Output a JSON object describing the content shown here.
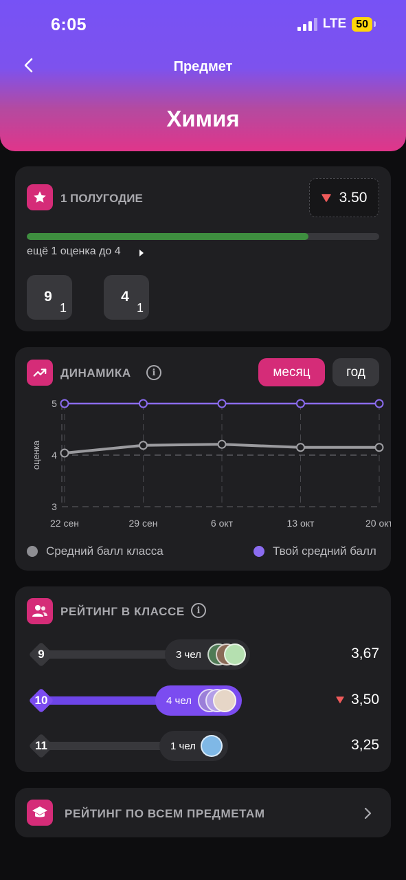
{
  "status_bar": {
    "time": "6:05",
    "network": "LTE",
    "battery": "50"
  },
  "nav": {
    "title": "Предмет",
    "back_icon": "chevron-left-icon"
  },
  "subject": "Химия",
  "semester_card": {
    "title": "1 ПОЛУГОДИЕ",
    "icon": "star-icon",
    "average": "3.50",
    "progress": 0.8,
    "progress_color": "#3e8e3f",
    "hint": "ещё 1 оценка до 4",
    "grades": [
      {
        "grade": "9",
        "count": "1"
      },
      {
        "grade": "4",
        "count": "1"
      }
    ]
  },
  "dynamics_card": {
    "title": "ДИНАМИКА",
    "icon": "trend-up-icon",
    "toggle": {
      "month": "месяц",
      "year": "год",
      "active": "month"
    },
    "legend": {
      "class": "Средний балл класса",
      "you": "Твой средний балл"
    },
    "colors": {
      "class": "#8e8e93",
      "you": "#8b6cf0"
    }
  },
  "chart_data": {
    "type": "line",
    "categories": [
      "22 сен",
      "29 сен",
      "6 окт",
      "13 окт",
      "20 окт"
    ],
    "ylabel": "оценка",
    "ylim": [
      3,
      5
    ],
    "yticks": [
      "5",
      "4",
      "3"
    ],
    "reference_line": 4,
    "series": [
      {
        "name": "Твой средний балл",
        "values": [
          5.0,
          5.0,
          5.0,
          5.0,
          5.0
        ]
      },
      {
        "name": "Средний балл класса",
        "values": [
          4.04,
          4.19,
          4.21,
          4.15,
          4.15
        ]
      }
    ]
  },
  "rating_card": {
    "title": "РЕЙТИНГ В КЛАССЕ",
    "icon": "users-icon",
    "rows": [
      {
        "rank": "9",
        "people": "3 чел",
        "score": "3,67",
        "you": false
      },
      {
        "rank": "10",
        "people": "4 чел",
        "score": "3,50",
        "you": true
      },
      {
        "rank": "11",
        "people": "1 чел",
        "score": "3,25",
        "you": false
      }
    ]
  },
  "all_subjects": {
    "title": "РЕЙТИНГ ПО ВСЕМ ПРЕДМЕТАМ",
    "icon": "graduation-cap-icon"
  }
}
